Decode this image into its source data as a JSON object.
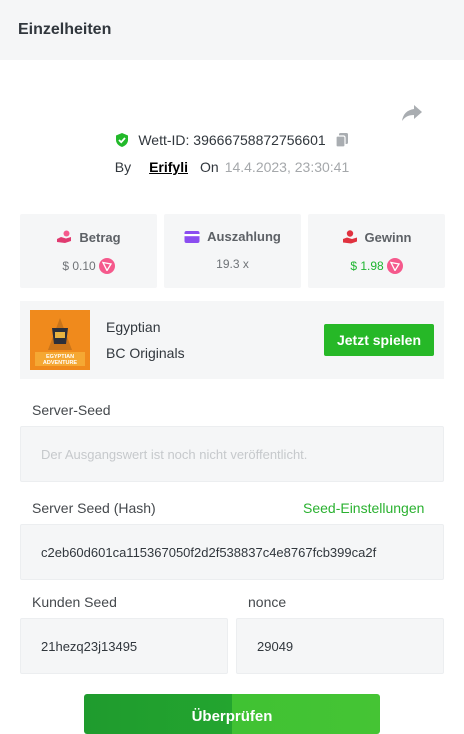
{
  "header": {
    "title": "Einzelheiten"
  },
  "bet": {
    "id_label": "Wett-ID: 39666758872756601",
    "by_label": "By",
    "user": "Erifyli",
    "on_label": "On",
    "date": "14.4.2023, 23:30:41"
  },
  "stats": [
    {
      "title": "Betrag",
      "value": "$ 0.10",
      "icon": "bet-hand-icon"
    },
    {
      "title": "Auszahlung",
      "value": "19.3 x",
      "icon": "card-icon"
    },
    {
      "title": "Gewinn",
      "value": "$ 1.98",
      "icon": "win-hand-icon"
    }
  ],
  "game": {
    "name": "Egyptian",
    "provider": "BC Originals",
    "thumb_text": "EGYPTIAN ADVENTURE",
    "play_label": "Jetzt spielen"
  },
  "server_seed": {
    "label": "Server-Seed",
    "placeholder": "Der Ausgangswert ist noch nicht veröffentlicht."
  },
  "server_seed_hash": {
    "label": "Server Seed (Hash)",
    "settings_link": "Seed-Einstellungen",
    "value": "c2eb60d601ca115367050f2d2f538837c4e8767fcb399ca2f"
  },
  "client_seed": {
    "label": "Kunden Seed",
    "value": "21hezq23j13495"
  },
  "nonce": {
    "label": "nonce",
    "value": "29049"
  },
  "verify": {
    "label": "Überprüfen"
  },
  "colors": {
    "accent": "#26b827",
    "coin": "#f5598c",
    "panel": "#f5f6f7"
  }
}
